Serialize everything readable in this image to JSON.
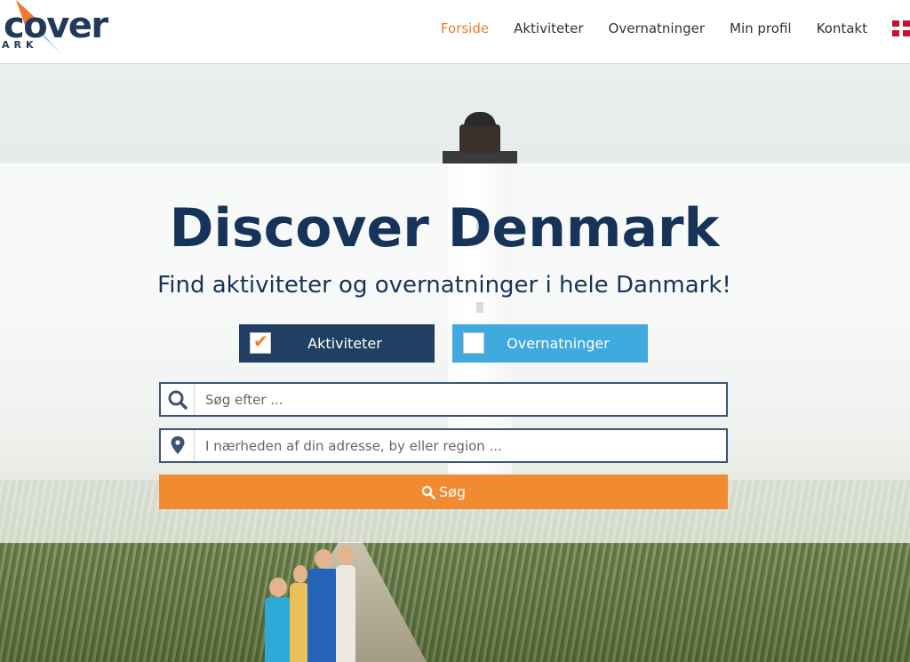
{
  "brand": {
    "logo_text": "cover",
    "logo_subtext": "ARK"
  },
  "nav": {
    "items": [
      {
        "label": "Forside",
        "active": true
      },
      {
        "label": "Aktiviteter",
        "active": false
      },
      {
        "label": "Overnatninger",
        "active": false
      },
      {
        "label": "Min profil",
        "active": false
      },
      {
        "label": "Kontakt",
        "active": false
      }
    ],
    "language_icon": "danish-flag-icon"
  },
  "hero": {
    "title": "Discover Denmark",
    "subtitle": "Find aktiviteter og overnatninger i hele Danmark!"
  },
  "toggles": [
    {
      "label": "Aktiviteter",
      "checked": true
    },
    {
      "label": "Overnatninger",
      "checked": false
    }
  ],
  "search": {
    "query_placeholder": "Søg efter ...",
    "location_placeholder": "I nærheden af din adresse, by eller region ...",
    "button_label": "Søg",
    "icons": {
      "query": "search-icon",
      "location": "map-pin-icon",
      "button": "search-icon"
    }
  },
  "colors": {
    "brand_navy": "#163459",
    "accent_orange": "#f28a32",
    "nav_active": "#ee7a2c",
    "toggle_active": "#213f63",
    "toggle_inactive": "#40a9dd"
  }
}
